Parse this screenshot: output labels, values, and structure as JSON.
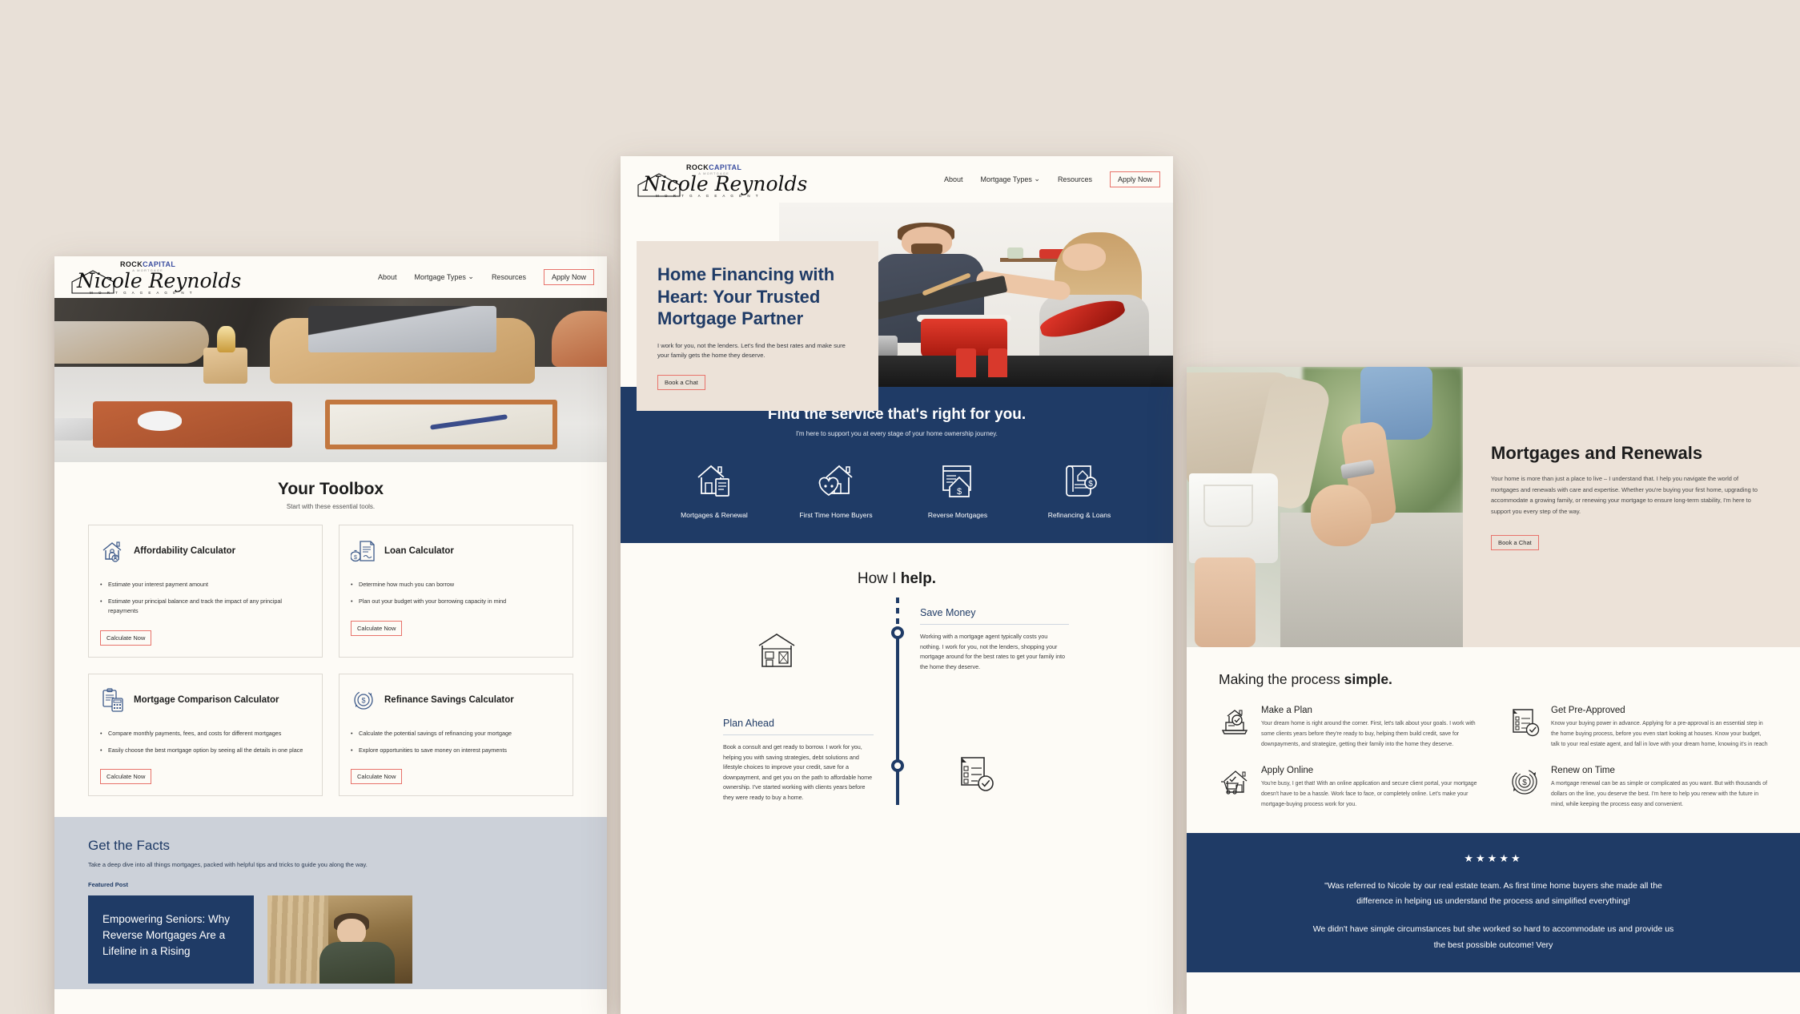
{
  "brand": {
    "rock": "ROCK",
    "capital": "CAPITAL",
    "rock_sub": "A MORTGAGE",
    "signature": "Nicole Reynolds",
    "signature_sub": "M O R T G A G E   A G E N T"
  },
  "nav": {
    "about": "About",
    "mortgage_types": "Mortgage Types",
    "chevron": "⌄",
    "resources": "Resources",
    "apply_now": "Apply Now"
  },
  "colors": {
    "page_background": "#e8e0d7",
    "panel_background": "#fdfbf6",
    "navy": "#1f3b66",
    "cta_border": "#e8736b",
    "brand_blue": "#3b4ea0",
    "facts_band": "#ccd1d9"
  },
  "left_panel": {
    "toolbox": {
      "title": "Your Toolbox",
      "subtitle": "Start with these essential tools.",
      "cards": [
        {
          "icon": "house-person-icon",
          "title": "Affordability Calculator",
          "bullets": [
            "Estimate your interest payment amount",
            "Estimate your principal balance and track the impact of any principal repayments"
          ],
          "button": "Calculate Now"
        },
        {
          "icon": "money-bag-document-icon",
          "title": "Loan Calculator",
          "bullets": [
            "Determine how much you can borrow",
            "Plan out your budget with your borrowing capacity in mind"
          ],
          "button": "Calculate Now"
        },
        {
          "icon": "clipboard-calculator-icon",
          "title": "Mortgage Comparison Calculator",
          "bullets": [
            "Compare monthly payments, fees, and costs for different mortgages",
            "Easily choose the best mortgage option by seeing all the details in one place"
          ],
          "button": "Calculate Now"
        },
        {
          "icon": "refinance-dollar-icon",
          "title": "Refinance Savings Calculator",
          "bullets": [
            "Calculate the potential savings of refinancing your mortgage",
            "Explore opportunities to save money on interest payments"
          ],
          "button": "Calculate Now"
        }
      ]
    },
    "facts": {
      "title": "Get the Facts",
      "subtitle": "Take a deep dive into all things mortgages, packed with helpful tips and tricks to guide you along the way.",
      "featured_label": "Featured Post",
      "featured_title": "Empowering Seniors: Why Reverse Mortgages Are a Lifeline in a Rising"
    }
  },
  "middle_panel": {
    "hero": {
      "title": "Home Financing with Heart: Your Trusted Mortgage Partner",
      "body": "I work for you, not the lenders. Let's find the best rates and make sure your family gets the home they deserve.",
      "button": "Book a Chat",
      "photo": "couple-cooking-in-kitchen"
    },
    "services": {
      "title": "Find the service that's right for you.",
      "subtitle": "I'm here to support you at every stage of your home ownership journey.",
      "items": [
        {
          "icon": "house-document-icon",
          "label": "Mortgages & Renewal"
        },
        {
          "icon": "house-heart-icon",
          "label": "First Time Home Buyers"
        },
        {
          "icon": "reverse-mortgage-icon",
          "label": "Reverse Mortgages"
        },
        {
          "icon": "scroll-dollar-icon",
          "label": "Refinancing & Loans"
        }
      ]
    },
    "how_i_help": {
      "title_light": "How I ",
      "title_bold": "help.",
      "steps": [
        {
          "icon": "house-front-icon",
          "side": "left",
          "heading": "Plan Ahead",
          "body": "Book a consult and get ready to borrow. I work for you, helping you with saving strategies, debt solutions and lifestyle choices to improve your credit, save for a downpayment, and get you on the path to affordable home ownership. I've started working with clients years before they were ready to buy a home.",
          "bold_word": "you"
        },
        {
          "icon": "checklist-approved-icon",
          "side": "right",
          "heading": "Save Money",
          "body": "Working with a mortgage agent typically costs you nothing. I work for you, not the lenders, shopping your mortgage around for the best rates to get your family into the home they deserve.",
          "bold_word": "you"
        }
      ]
    }
  },
  "right_panel": {
    "intro": {
      "title": "Mortgages and Renewals",
      "body": "Your home is more than just a place to live – I understand that. I help you navigate the world of mortgages and renewals with care and expertise. Whether you're buying your first home, upgrading to accommodate a growing family, or renewing your mortgage to ensure long-term stability, I'm here to support you every step of the way.",
      "button": "Book a Chat",
      "photo": "couple-holding-hands"
    },
    "process": {
      "title_light": "Making the process ",
      "title_bold": "simple.",
      "items": [
        {
          "icon": "laptop-house-approved-icon",
          "heading": "Make a Plan",
          "body": "Your dream home is right around the corner. First, let's talk about your goals. I work with some clients years before they're ready to buy, helping them build credit, save for downpayments, and strategize, getting their family into the home they deserve."
        },
        {
          "icon": "checklist-approved-icon",
          "heading": "Get Pre-Approved",
          "body": "Know your buying power in advance. Applying for a pre-approval is an essential step in the home buying process, before you even start looking at houses. Know your budget, talk to your real estate agent, and fall in love with your dream home, knowing it's in reach"
        },
        {
          "icon": "house-cart-icon",
          "heading": "Apply Online",
          "body": "You're busy, I get that! With an online application and secure client portal, your mortgage doesn't have to be a hassle. Work face to face, or completely online. Let's make your mortgage-buying process work for you."
        },
        {
          "icon": "refinance-dollar-icon",
          "heading": "Renew on Time",
          "body": "A mortgage renewal can be as simple or complicated as you want. But with thousands of dollars on the line, you deserve the best. I'm here to help you renew with the future in mind, while keeping the process easy and convenient."
        }
      ]
    },
    "testimonial": {
      "stars": "★★★★★",
      "paragraph_1": "\"Was referred to Nicole by our real estate team. As first time home buyers she made all the difference in helping us understand the process and simplified everything!",
      "paragraph_2": "We didn't have simple circumstances but she worked so hard to accommodate us and provide us the best possible outcome! Very"
    }
  }
}
